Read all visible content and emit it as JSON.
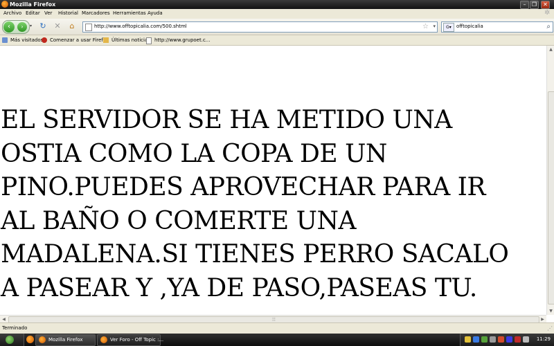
{
  "window": {
    "title": "Mozilla Firefox"
  },
  "menu": [
    "Archivo",
    "Editar",
    "Ver",
    "Historial",
    "Marcadores",
    "Herramientas",
    "Ayuda"
  ],
  "navigation": {
    "url": "http://www.offtopicalia.com/500.shtml",
    "search_value": "offtopicalia"
  },
  "bookmarks": [
    {
      "label": "Más visitados",
      "icon": "bookmark-page-icon"
    },
    {
      "label": "Comenzar a usar Firef...",
      "icon": "firefox-start-icon"
    },
    {
      "label": "Últimas noticias",
      "icon": "rss-folder-icon"
    },
    {
      "label": "http://www.grupoet.c...",
      "icon": "page-icon"
    }
  ],
  "content": {
    "message_lines": [
      "EL SERVIDOR SE HA METIDO UNA",
      "OSTIA COMO LA COPA DE UN",
      "PINO.PUEDES APROVECHAR PARA IR",
      "AL BAÑO O COMERTE UNA",
      "MADALENA.SI TIENES PERRO SACALO",
      "A PASEAR Y ,YA DE PASO,PASEAS TU."
    ]
  },
  "status": {
    "text": "Terminado"
  },
  "taskbar": {
    "tasks": [
      {
        "label": "Mozilla Firefox",
        "active": true
      },
      {
        "label": "Ver Foro - Off Topic :...",
        "active": false
      }
    ],
    "clock": "11:29"
  },
  "colors": {
    "title_bar": "#121212",
    "chrome": "#ece9d8",
    "nav_green": "#2f9724",
    "page_bg": "#ffffff",
    "text": "#000000"
  }
}
